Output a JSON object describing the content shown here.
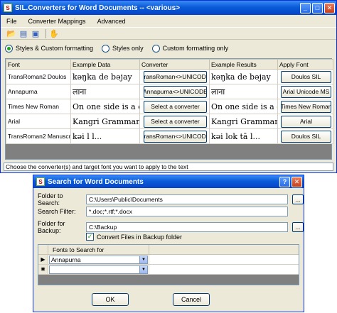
{
  "main_window": {
    "title": "SIL.Converters for Word Documents -- <various>",
    "menu": [
      "File",
      "Converter Mappings",
      "Advanced"
    ],
    "toolbar_icons": [
      "open-folder-icon",
      "documents-icon",
      "save-icon",
      "hand-icon"
    ],
    "radio_options": [
      {
        "label": "Styles & Custom formatting",
        "selected": true
      },
      {
        "label": "Styles only",
        "selected": false
      },
      {
        "label": "Custom formatting only",
        "selected": false
      }
    ],
    "grid": {
      "headers": [
        "Font",
        "Example Data",
        "Converter",
        "Example Results",
        "Apply Font"
      ],
      "rows": [
        {
          "font": "TransRoman2 Doulos",
          "example": "kəŋka de bəjay",
          "converter": "TransRoman<>UNICODE",
          "result": "kəŋka de bəjay",
          "apply": "Doulos SIL"
        },
        {
          "font": "Annapurna",
          "example": "लाना",
          "converter": "Annapurna<>UNICODE",
          "result": "लाना",
          "apply": "Arial Unicode MS"
        },
        {
          "font": "Times New Roman",
          "example": "On one side is a ca...",
          "converter": "Select a converter",
          "result": "On one side is a ca...",
          "apply": "Times New Roman"
        },
        {
          "font": "Arial",
          "example": "Kangri Grammar...",
          "converter": "Select a converter",
          "result": "Kangri Grammar...",
          "apply": "Arial"
        },
        {
          "font": "TransRoman2 Manuscript",
          "example": "kəi    l    l...",
          "converter": "TransRoman<>UNICODE",
          "result": "kəi    lok  tā    l...",
          "apply": "Doulos SIL"
        }
      ]
    },
    "status": "Choose the converter(s) and target font you want to apply to the text"
  },
  "dialog": {
    "title": "Search for Word Documents",
    "folder_label": "Folder to Search:",
    "folder_value": "C:\\Users\\Public\\Documents",
    "filter_label": "Search Filter:",
    "filter_value": "*.doc;*.rtf;*.docx",
    "backup_label": "Folder for Backup:",
    "backup_value": "C:\\Backup",
    "browse_label": "...",
    "convert_backup_label": "Convert Files in Backup folder",
    "fonts_header": "Fonts to Search for",
    "fonts": [
      "Annapurna"
    ],
    "ok_label": "OK",
    "cancel_label": "Cancel"
  }
}
